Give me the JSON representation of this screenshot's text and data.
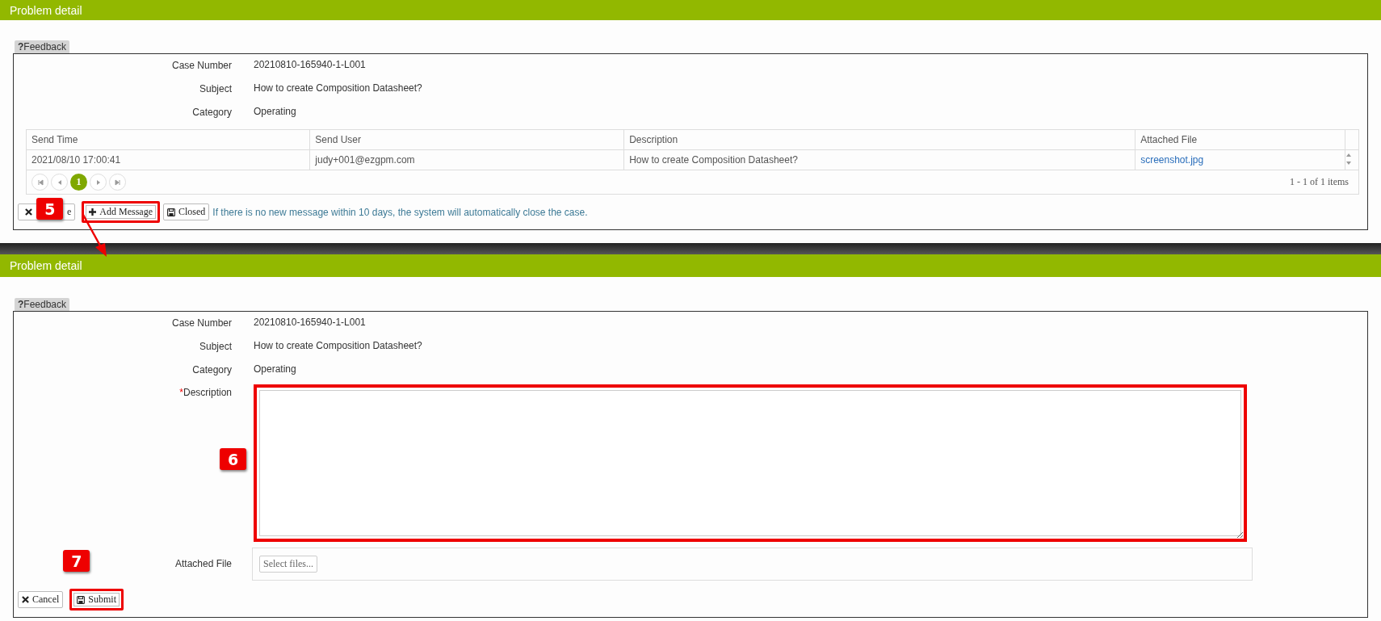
{
  "panels": [
    {
      "title": "Problem detail",
      "feedback": "**?**Feedback",
      "fields": [
        {
          "label": "Case Number",
          "value": "20210810-165940-1-L001"
        },
        {
          "label": "Subject",
          "value": "How to create Composition Datasheet?"
        },
        {
          "label": "Category",
          "value": "Operating"
        }
      ],
      "table": {
        "columns": [
          "Send Time",
          "Send User",
          "Description",
          "Attached File"
        ],
        "rows": [
          {
            "cells": [
              "2021/08/10 17:00:41",
              "judy+001@ezgpm.com",
              "How to create Composition Datasheet?",
              "screenshot.jpg"
            ]
          }
        ],
        "pages": [
          {
            "label": "1",
            "selected": true
          }
        ],
        "summary": "1 - 1 of 1 items"
      },
      "actions": [
        {
          "kind": "close",
          "label": "e",
          "highlighted": false
        },
        {
          "kind": "add",
          "label": "Add Message",
          "highlighted": true,
          "badge": "5"
        },
        {
          "kind": "save",
          "label": "Closed",
          "highlighted": false
        }
      ],
      "notice": "If there is no new message within 10 days, the system will automatically close the case."
    },
    {
      "title": "Problem detail",
      "feedback": "**?**Feedback",
      "fields": [
        {
          "label": "Case Number",
          "value": "20210810-165940-1-L001"
        },
        {
          "label": "Subject",
          "value": "How to create Composition Datasheet?"
        },
        {
          "label": "Category",
          "value": "Operating"
        }
      ],
      "description": {
        "label": "Description",
        "required": true,
        "required_mark": "*",
        "highlighted": true,
        "badge": "6"
      },
      "attachment": {
        "label": "Attached File",
        "button": "Select files..."
      },
      "actions": [
        {
          "kind": "close",
          "label": "Cancel",
          "highlighted": false
        },
        {
          "kind": "save",
          "label": "Submit",
          "highlighted": true,
          "badge": "7"
        }
      ]
    }
  ]
}
